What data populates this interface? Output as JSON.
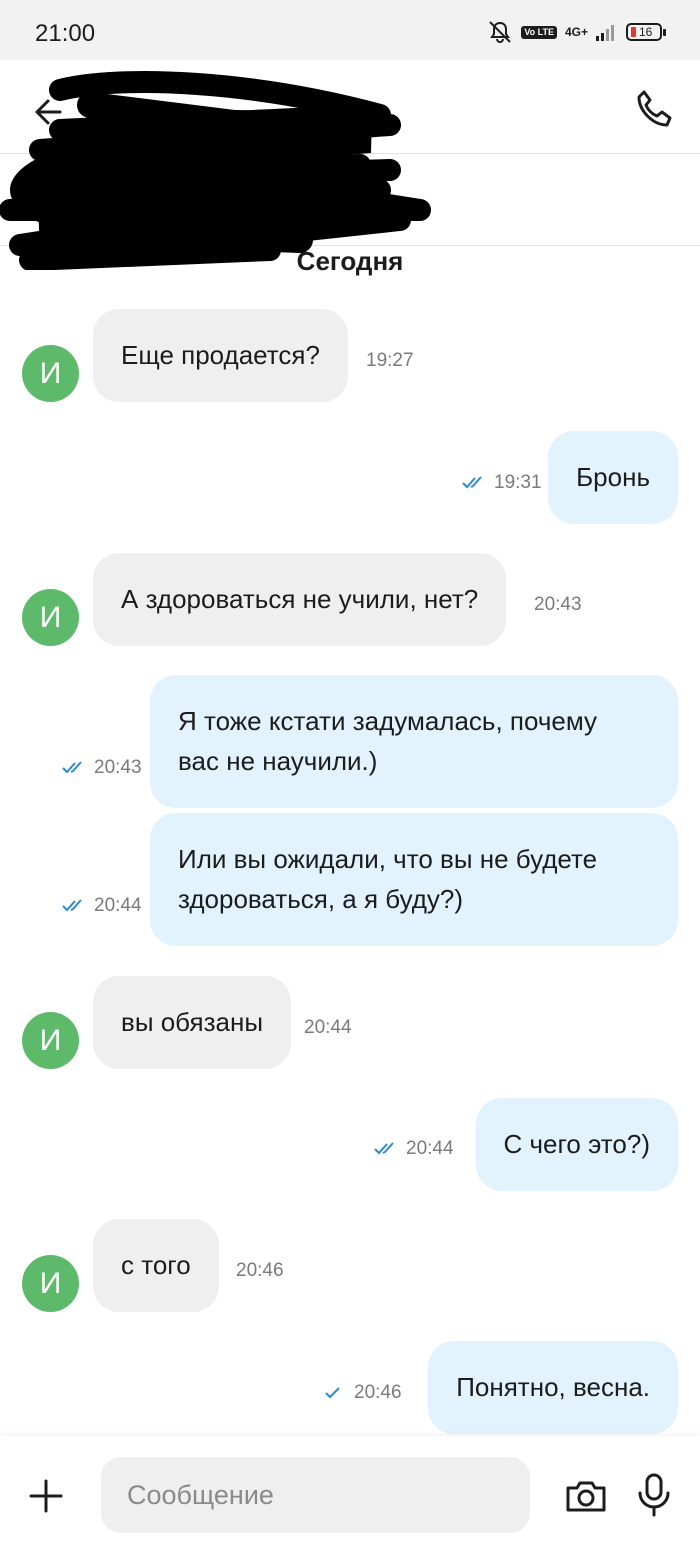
{
  "status_bar": {
    "time": "21:00",
    "volte": "Vo LTE",
    "network": "4G+",
    "battery": "16"
  },
  "header": {
    "back_icon": "arrow-left-icon",
    "call_icon": "phone-icon",
    "contact_name": ""
  },
  "date_separator": "Сегодня",
  "avatar_letter": "И",
  "messages": [
    {
      "dir": "in",
      "text": "Еще продается?",
      "time": "19:27"
    },
    {
      "dir": "out",
      "text": "Бронь",
      "time": "19:31",
      "status": "read"
    },
    {
      "dir": "in",
      "text": "А здороваться не учили, нет?",
      "time": "20:43"
    },
    {
      "dir": "out",
      "text": "Я тоже кстати задумалась, почему\nвас не научили.)",
      "time": "20:43",
      "status": "read"
    },
    {
      "dir": "out",
      "text": "Или вы ожидали, что вы не будете\nздороваться, а я буду?)",
      "time": "20:44",
      "status": "read"
    },
    {
      "dir": "in",
      "text": "вы обязаны",
      "time": "20:44"
    },
    {
      "dir": "out",
      "text": "С чего это?)",
      "time": "20:44",
      "status": "read"
    },
    {
      "dir": "in",
      "text": "с того",
      "time": "20:46"
    },
    {
      "dir": "out",
      "text": "Понятно, весна.",
      "time": "20:46",
      "status": "sent"
    }
  ],
  "composer": {
    "placeholder": "Сообщение",
    "value": ""
  },
  "colors": {
    "incoming_bubble": "#f0efef",
    "outgoing_bubble": "#e2f3fd",
    "avatar": "#5cba6a",
    "tick": "#2a8ad4"
  }
}
